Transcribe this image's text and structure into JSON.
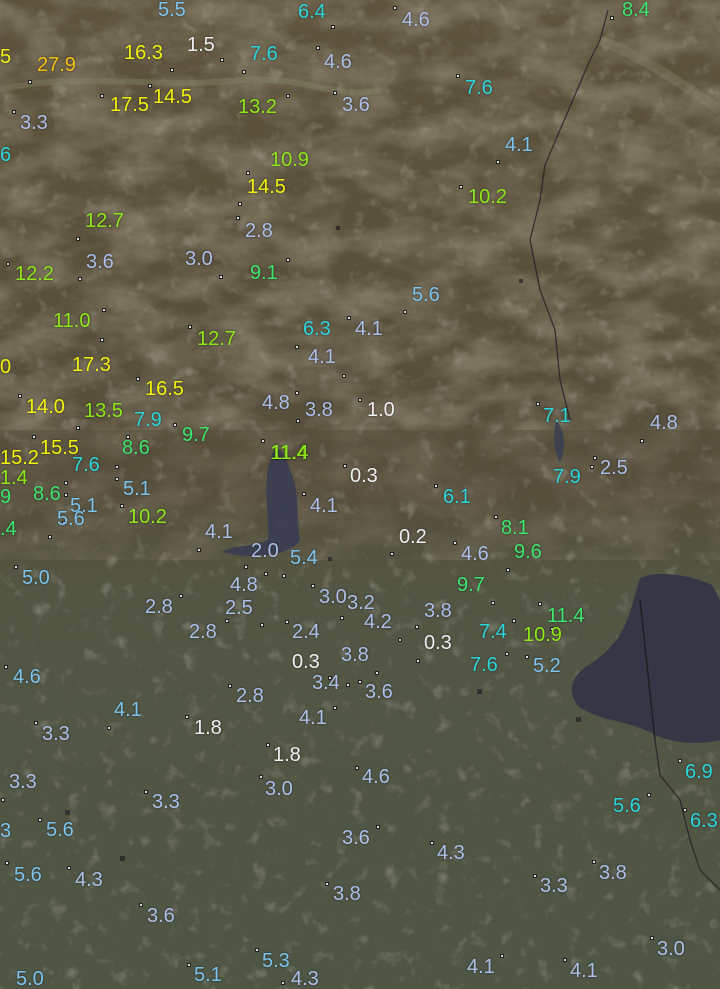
{
  "map": {
    "stations": [
      {
        "v": "5.5",
        "c": "blue"
      },
      {
        "v": "6.4",
        "c": "cyan"
      },
      {
        "v": "4.6",
        "c": "lav"
      },
      {
        "v": "8.4",
        "c": "green"
      },
      {
        "v": "5",
        "c": "yellow"
      },
      {
        "v": "27.9",
        "c": "orange"
      },
      {
        "v": "16.3",
        "c": "yellow"
      },
      {
        "v": "1.5",
        "c": "white"
      },
      {
        "v": "7.6",
        "c": "cyan"
      },
      {
        "v": "4.6",
        "c": "lav"
      },
      {
        "v": "17.5",
        "c": "yellow"
      },
      {
        "v": "14.5",
        "c": "yellow"
      },
      {
        "v": "13.2",
        "c": "lime"
      },
      {
        "v": "3.6",
        "c": "lav"
      },
      {
        "v": "7.6",
        "c": "cyan"
      },
      {
        "v": "3.3",
        "c": "lav"
      },
      {
        "v": "6",
        "c": "cyan"
      },
      {
        "v": "4.1",
        "c": "blue"
      },
      {
        "v": "10.9",
        "c": "lime"
      },
      {
        "v": "14.5",
        "c": "yellow"
      },
      {
        "v": "10.2",
        "c": "lime"
      },
      {
        "v": "12.7",
        "c": "lime"
      },
      {
        "v": "2.8",
        "c": "lav"
      },
      {
        "v": "12.2",
        "c": "lime"
      },
      {
        "v": "3.6",
        "c": "lav"
      },
      {
        "v": "3.0",
        "c": "lav"
      },
      {
        "v": "9.1",
        "c": "green"
      },
      {
        "v": "5.6",
        "c": "blue"
      },
      {
        "v": "11.0",
        "c": "lime"
      },
      {
        "v": "6.3",
        "c": "cyan"
      },
      {
        "v": "4.1",
        "c": "lav"
      },
      {
        "v": "12.7",
        "c": "lime"
      },
      {
        "v": "4.1",
        "c": "lav"
      },
      {
        "v": "0",
        "c": "yellow"
      },
      {
        "v": "17.3",
        "c": "yellow"
      },
      {
        "v": "16.5",
        "c": "yellow"
      },
      {
        "v": "14.0",
        "c": "yellow"
      },
      {
        "v": "13.5",
        "c": "lime"
      },
      {
        "v": "7.9",
        "c": "cyan"
      },
      {
        "v": "4.8",
        "c": "lav"
      },
      {
        "v": "3.8",
        "c": "lav"
      },
      {
        "v": "1.0",
        "c": "white"
      },
      {
        "v": "7.1",
        "c": "cyan"
      },
      {
        "v": "4.8",
        "c": "lav"
      },
      {
        "v": "9.7",
        "c": "green"
      },
      {
        "v": "15.2",
        "c": "yellow"
      },
      {
        "v": "15.5",
        "c": "yellow"
      },
      {
        "v": "8.6",
        "c": "green"
      },
      {
        "v": "11.4",
        "c": "lime"
      },
      {
        "v": "1.4",
        "c": "lime"
      },
      {
        "v": "7.6",
        "c": "cyan"
      },
      {
        "v": "0.3",
        "c": "white"
      },
      {
        "v": "7.9",
        "c": "cyan"
      },
      {
        "v": "2.5",
        "c": "lav"
      },
      {
        "v": "9",
        "c": "green"
      },
      {
        "v": "8.6",
        "c": "green"
      },
      {
        "v": "5.1",
        "c": "blue"
      },
      {
        "v": "6.1",
        "c": "cyan"
      },
      {
        "v": "5.1",
        "c": "blue"
      },
      {
        "v": "4.1",
        "c": "lav"
      },
      {
        "v": "10.2",
        "c": "lime"
      },
      {
        "v": "5.6",
        "c": "blue"
      },
      {
        "v": "8.1",
        "c": "green"
      },
      {
        "v": ".4",
        "c": "green"
      },
      {
        "v": "4.1",
        "c": "lav"
      },
      {
        "v": "0.2",
        "c": "white"
      },
      {
        "v": "2.0",
        "c": "lav"
      },
      {
        "v": "5.4",
        "c": "blue"
      },
      {
        "v": "4.6",
        "c": "lav"
      },
      {
        "v": "9.6",
        "c": "green"
      },
      {
        "v": "5.0",
        "c": "blue"
      },
      {
        "v": "9.7",
        "c": "green"
      },
      {
        "v": "11.4",
        "c": "green"
      },
      {
        "v": "4.8",
        "c": "lav"
      },
      {
        "v": "3.0",
        "c": "lav"
      },
      {
        "v": "3.2",
        "c": "lav"
      },
      {
        "v": "2.8",
        "c": "lav"
      },
      {
        "v": "2.5",
        "c": "lav"
      },
      {
        "v": "3.8",
        "c": "lav"
      },
      {
        "v": "11.4",
        "c": "lime"
      },
      {
        "v": "4.2",
        "c": "lav"
      },
      {
        "v": "7.4",
        "c": "cyan"
      },
      {
        "v": "2.8",
        "c": "lav"
      },
      {
        "v": "2.4",
        "c": "lav"
      },
      {
        "v": "10.9",
        "c": "lime"
      },
      {
        "v": "0.3",
        "c": "white"
      },
      {
        "v": "3.8",
        "c": "lav"
      },
      {
        "v": "0.3",
        "c": "white"
      },
      {
        "v": "7.6",
        "c": "cyan"
      },
      {
        "v": "5.2",
        "c": "blue"
      },
      {
        "v": "4.6",
        "c": "blue"
      },
      {
        "v": "3.4",
        "c": "lav"
      },
      {
        "v": "3.6",
        "c": "lav"
      },
      {
        "v": "2.8",
        "c": "lav"
      },
      {
        "v": "4.1",
        "c": "lav"
      },
      {
        "v": "4.1",
        "c": "blue"
      },
      {
        "v": "1.8",
        "c": "white"
      },
      {
        "v": "3.3",
        "c": "lav"
      },
      {
        "v": "1.8",
        "c": "white"
      },
      {
        "v": "6.9",
        "c": "cyan"
      },
      {
        "v": "3.3",
        "c": "lav"
      },
      {
        "v": "4.6",
        "c": "lav"
      },
      {
        "v": "3.3",
        "c": "lav"
      },
      {
        "v": "3.0",
        "c": "lav"
      },
      {
        "v": "5.6",
        "c": "cyan"
      },
      {
        "v": "3",
        "c": "blue"
      },
      {
        "v": "5.6",
        "c": "blue"
      },
      {
        "v": "6.3",
        "c": "cyan"
      },
      {
        "v": "3.6",
        "c": "lav"
      },
      {
        "v": "4.3",
        "c": "lav"
      },
      {
        "v": "5.6",
        "c": "blue"
      },
      {
        "v": "4.3",
        "c": "lav"
      },
      {
        "v": "3.8",
        "c": "lav"
      },
      {
        "v": "3.3",
        "c": "lav"
      },
      {
        "v": "3.8",
        "c": "lav"
      },
      {
        "v": "3.6",
        "c": "lav"
      },
      {
        "v": "3.0",
        "c": "lav"
      },
      {
        "v": "5.0",
        "c": "blue"
      },
      {
        "v": "5.1",
        "c": "blue"
      },
      {
        "v": "5.3",
        "c": "blue"
      },
      {
        "v": "4.1",
        "c": "lav"
      },
      {
        "v": "4.1",
        "c": "lav"
      },
      {
        "v": "4.3",
        "c": "lav"
      }
    ]
  }
}
